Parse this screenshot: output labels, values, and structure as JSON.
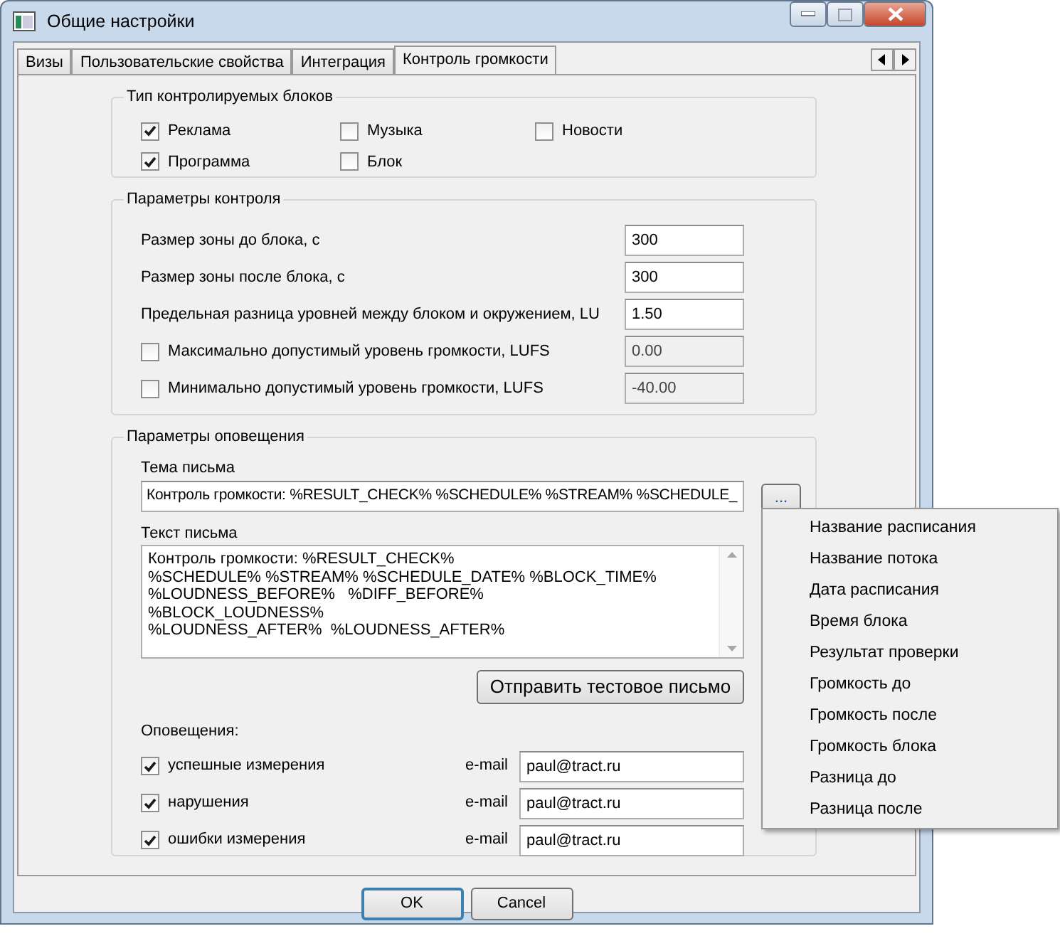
{
  "window": {
    "title": "Общие настройки"
  },
  "tabs": [
    {
      "label": "Визы",
      "selected": false
    },
    {
      "label": "Пользовательские свойства",
      "selected": false
    },
    {
      "label": "Интеграция",
      "selected": false
    },
    {
      "label": "Контроль громкости",
      "selected": true
    }
  ],
  "block_types": {
    "title": "Тип контролируемых блоков",
    "items": [
      {
        "label": "Реклама",
        "checked": true
      },
      {
        "label": "Музыка",
        "checked": false
      },
      {
        "label": "Новости",
        "checked": false
      },
      {
        "label": "Программа",
        "checked": true
      },
      {
        "label": "Блок",
        "checked": false
      }
    ]
  },
  "control_params": {
    "title": "Параметры контроля",
    "rows": [
      {
        "kind": "field",
        "label": "Размер зоны до блока, с",
        "value": "300",
        "disabled": false
      },
      {
        "kind": "field",
        "label": "Размер зоны после блока, с",
        "value": "300",
        "disabled": false
      },
      {
        "kind": "field",
        "label": "Предельная разница уровней между блоком и окружением, LU",
        "value": "1.50",
        "disabled": false
      },
      {
        "kind": "checkbox",
        "label": "Максимально допустимый уровень громкости, LUFS",
        "checked": false,
        "value": "0.00",
        "disabled": true
      },
      {
        "kind": "checkbox",
        "label": "Минимально допустимый уровень громкости, LUFS",
        "checked": false,
        "value": "-40.00",
        "disabled": true
      }
    ]
  },
  "notification": {
    "title": "Параметры оповещения",
    "subject_label": "Тема письма",
    "subject": "Контроль громкости: %RESULT_CHECK% %SCHEDULE% %STREAM% %SCHEDULE_",
    "insert_button": "...",
    "body_label": "Текст письма",
    "body": "Контроль громкости: %RESULT_CHECK%\n%SCHEDULE% %STREAM% %SCHEDULE_DATE% %BLOCK_TIME%\n%LOUDNESS_BEFORE%   %DIFF_BEFORE%\n%BLOCK_LOUDNESS%\n%LOUDNESS_AFTER%  %LOUDNESS_AFTER%",
    "test_button": "Отправить тестовое письмо",
    "alerts_label": "Оповещения:",
    "alerts": [
      {
        "label": "успешные измерения",
        "checked": true,
        "email_label": "e-mail",
        "email": "paul@tract.ru"
      },
      {
        "label": "нарушения",
        "checked": true,
        "email_label": "e-mail",
        "email": "paul@tract.ru"
      },
      {
        "label": "ошибки измерения",
        "checked": true,
        "email_label": "e-mail",
        "email": "paul@tract.ru"
      }
    ]
  },
  "buttons": [
    "OK",
    "Cancel"
  ],
  "popup_menu": {
    "items": [
      "Название расписания",
      "Название потока",
      "Дата расписания",
      "Время блока",
      "Результат проверки",
      "Громкость до",
      "Громкость после",
      "Громкость блока",
      "Разница до",
      "Разница после"
    ]
  }
}
